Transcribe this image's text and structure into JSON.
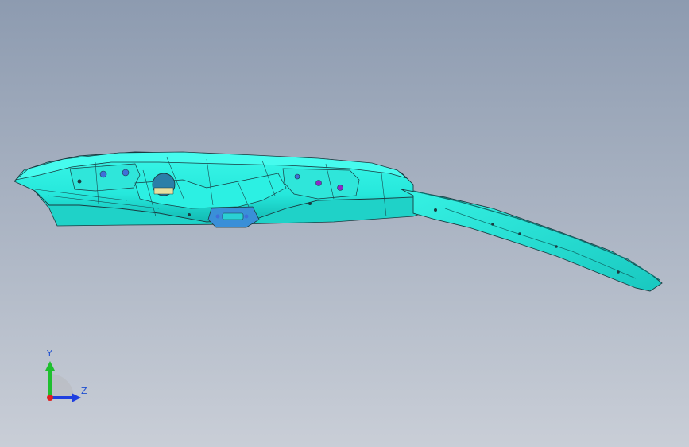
{
  "viewport": {
    "background_top": "#8d9bb0",
    "background_bottom": "#c8cdd6",
    "part_color": "#2ff5e6",
    "part_edge_color": "#1a3a40",
    "part_shadow_color": "#10a6a0",
    "hole_color": "#3f6fd8",
    "hole_accent_color": "#8a2bc8"
  },
  "triad": {
    "y_label": "Y",
    "z_label": "Z",
    "y_color": "#1fbf2f",
    "z_color": "#1f3fe0",
    "x_color": "#e02020",
    "label_color": "#1f4fd0",
    "icon": "coordinate-triad-icon"
  }
}
